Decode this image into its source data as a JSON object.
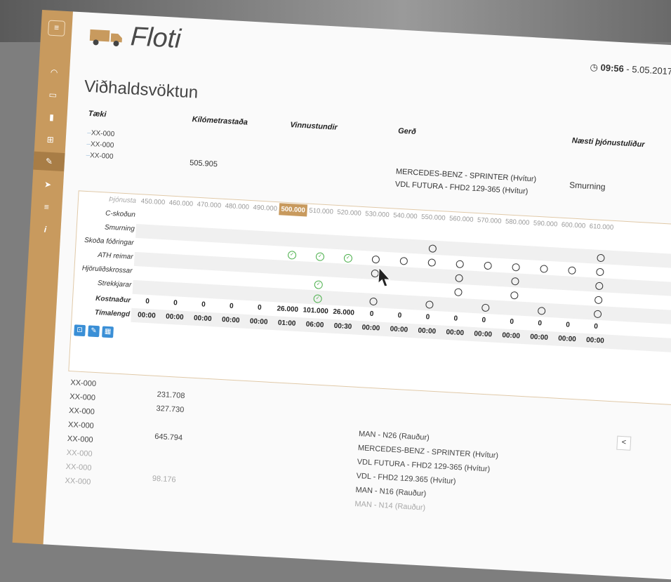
{
  "app": {
    "title": "Floti",
    "clock_icon": "clock-icon",
    "time": "09:56",
    "date_sep": " - 5.05.2017"
  },
  "page": {
    "title": "Viðhaldsvöktun"
  },
  "colors": {
    "sidebar": "#c89a5e",
    "active_column": "#c89a5e",
    "ok_green": "#4cb04c",
    "tool_blue": "#3a8fd6"
  },
  "sidebar": {
    "menu_icon": "menu-icon",
    "items": [
      {
        "icon": "dashboard-icon",
        "glyph": "◠"
      },
      {
        "icon": "calendar-icon",
        "glyph": "▭"
      },
      {
        "icon": "document-icon",
        "glyph": "▮"
      },
      {
        "icon": "map-icon",
        "glyph": "⊞"
      },
      {
        "icon": "wrench-icon",
        "glyph": "✎",
        "active": true
      },
      {
        "icon": "send-icon",
        "glyph": "➤"
      },
      {
        "icon": "list-icon",
        "glyph": "≡"
      },
      {
        "icon": "info-icon",
        "glyph": "i"
      }
    ]
  },
  "summary": {
    "headers": {
      "device": "Tæki",
      "km": "Kílómetrastaða",
      "hours": "Vinnustundir",
      "type": "Gerð",
      "next": "Næsti þjónustuliður"
    },
    "plates": [
      "XX-000",
      "XX-000",
      "XX-000"
    ],
    "km_value": "505.905",
    "types": [
      "MERCEDES-BENZ - SPRINTER (Hvítur)",
      "VDL FUTURA - FHD2 129-365 (Hvítur)"
    ],
    "next_service": "Smurning"
  },
  "grid": {
    "service_label": "Þjónusta",
    "columns": [
      "450.000",
      "460.000",
      "470.000",
      "480.000",
      "490.000",
      "500.000",
      "510.000",
      "520.000",
      "530.000",
      "540.000",
      "550.000",
      "560.000",
      "570.000",
      "580.000",
      "590.000",
      "600.000",
      "610.000"
    ],
    "active_column": "500.000",
    "rows": [
      "C-skoðun",
      "Smurning",
      "Skoða fóðringar",
      "ATH reimar",
      "Hjöruliðskrossar",
      "Strekkjarar"
    ],
    "cost_label": "Kostnaður",
    "time_label": "Tímalengd",
    "costs": [
      "0",
      "0",
      "0",
      "0",
      "0",
      "26.000",
      "101.000",
      "26.000",
      "0",
      "0",
      "0",
      "0",
      "0",
      "0",
      "0",
      "0",
      "0"
    ],
    "times": [
      "00:00",
      "00:00",
      "00:00",
      "00:00",
      "00:00",
      "01:00",
      "06:00",
      "00:30",
      "00:00",
      "00:00",
      "00:00",
      "00:00",
      "00:00",
      "00:00",
      "00:00",
      "00:00",
      "00:00"
    ],
    "tools": [
      "car-icon",
      "wrench-icon",
      "calendar-icon"
    ]
  },
  "list": {
    "plates": [
      "XX-000",
      "XX-000",
      "XX-000",
      "XX-000",
      "XX-000",
      "XX-000",
      "XX-000",
      "XX-000"
    ],
    "km": [
      "231.708",
      "327.730",
      "645.794",
      "98.176"
    ],
    "types": [
      "MAN - N26 (Rauður)",
      "MERCEDES-BENZ - SPRINTER (Hvítur)",
      "VDL FUTURA - FHD2 129-365 (Hvítur)",
      "VDL - FHD2 129.365 (Hvítur)",
      "MAN - N16 (Rauður)",
      "MAN - N14 (Rauður)"
    ],
    "prev_label": "<"
  }
}
